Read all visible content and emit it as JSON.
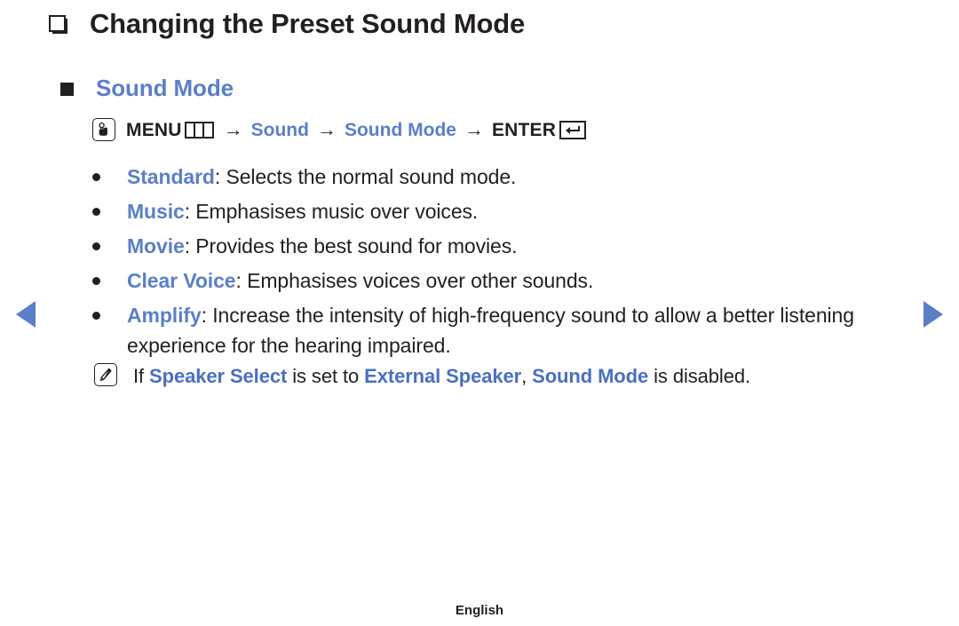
{
  "page": {
    "title": "Changing the Preset Sound Mode",
    "section_heading": "Sound Mode",
    "footer_language": "English",
    "accent_blue": "#5b7fc7",
    "note_blue": "#4a6fc0",
    "text_black": "#231f20"
  },
  "menu_path": {
    "press_icon": "hand-press-icon",
    "menu_label": "MENU",
    "menu_icon": "menu-grid-icon",
    "arrow": "→",
    "step_sound": "Sound",
    "step_sound_mode": "Sound Mode",
    "enter_label": "ENTER",
    "enter_icon": "enter-return-icon"
  },
  "options": [
    {
      "term": "Standard",
      "separator": ": ",
      "description": "Selects the normal sound mode."
    },
    {
      "term": "Music",
      "separator": ": ",
      "description": "Emphasises music over voices."
    },
    {
      "term": "Movie",
      "separator": ": ",
      "description": "Provides the best sound for movies."
    },
    {
      "term": "Clear Voice",
      "separator": ": ",
      "description": "Emphasises voices over other sounds."
    },
    {
      "term": "Amplify",
      "separator": ": ",
      "description": "Increase the intensity of high-frequency sound to allow a better listening experience for the hearing impaired."
    }
  ],
  "note": {
    "icon": "note-pencil-icon",
    "lead": "If ",
    "emphasis_1": "Speaker Select",
    "mid_1": " is set to ",
    "emphasis_2": "External Speaker",
    "mid_2": ", ",
    "emphasis_3": "Sound Mode",
    "tail": " is disabled."
  },
  "navigation": {
    "prev_icon": "previous-page-arrow-icon",
    "next_icon": "next-page-arrow-icon"
  }
}
